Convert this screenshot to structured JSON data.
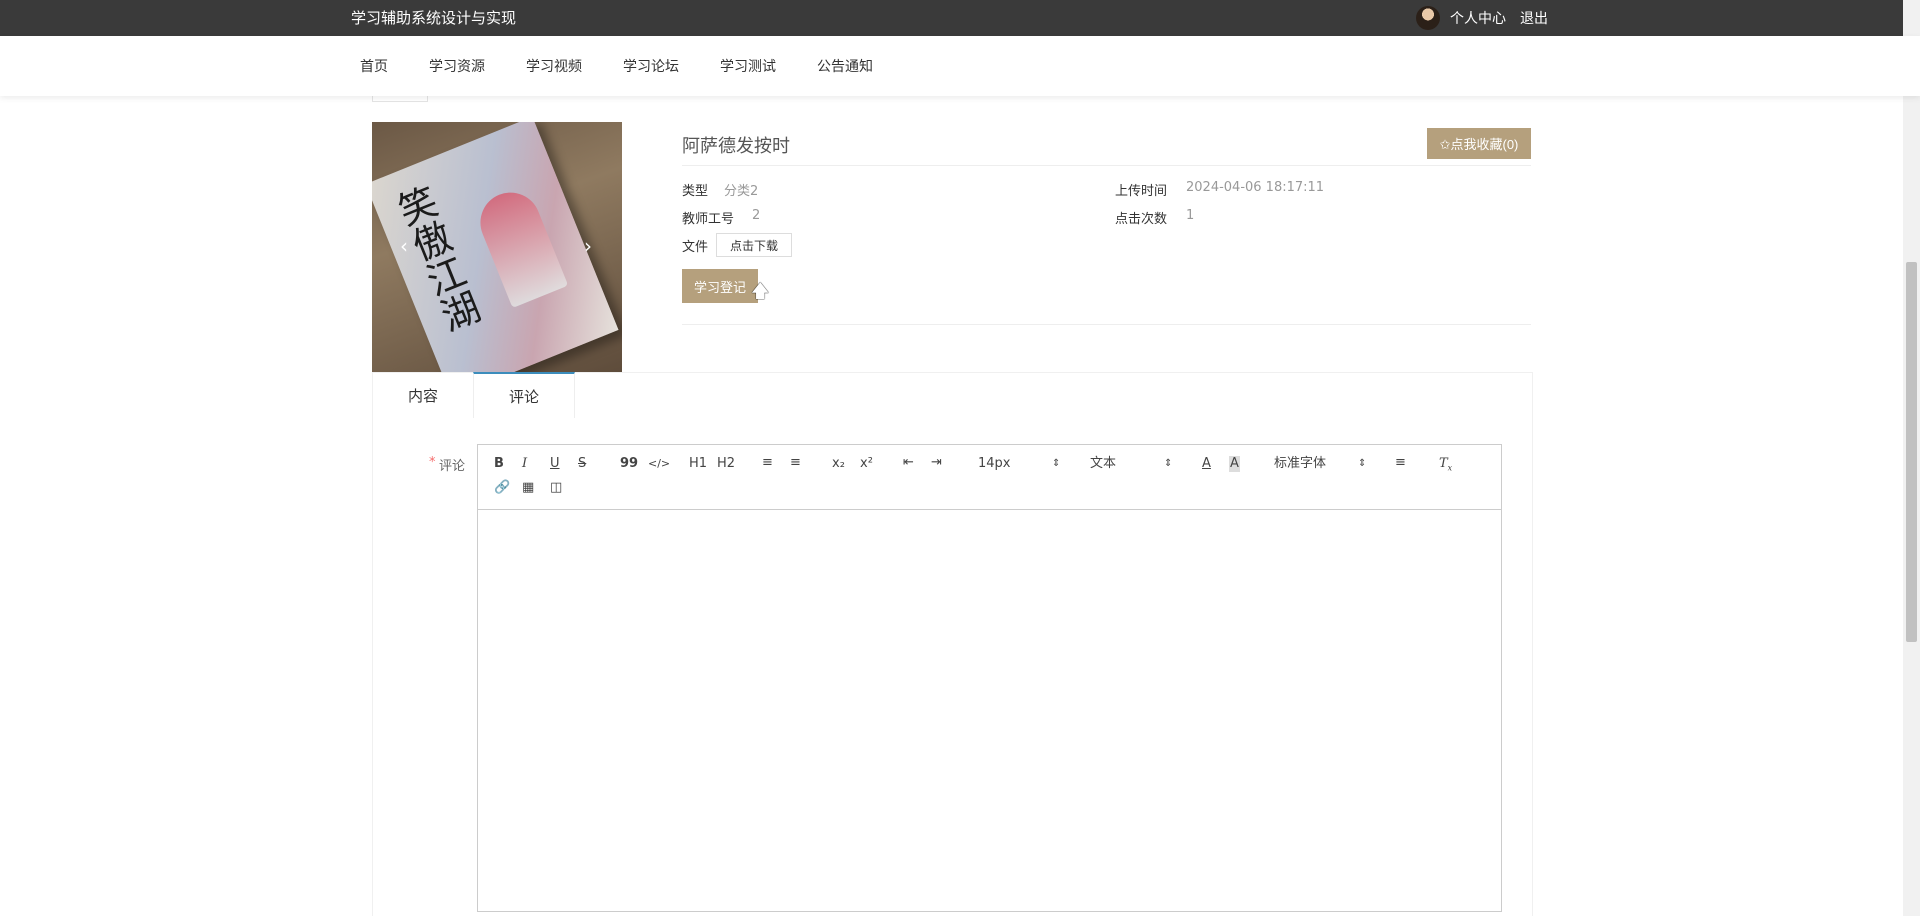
{
  "header": {
    "site_title": "学习辅助系统设计与实现",
    "personal_center": "个人中心",
    "logout": "退出"
  },
  "nav": {
    "items": [
      "首页",
      "学习资源",
      "学习视频",
      "学习论坛",
      "学习测试",
      "公告通知"
    ]
  },
  "cover": {
    "book_text": "笑傲江湖",
    "prev": "‹",
    "next": "›"
  },
  "detail": {
    "title": "阿萨德发按时",
    "favorite_button": "✩点我收藏(0)",
    "type_label": "类型",
    "type_value": "分类2",
    "teacher_label": "教师工号",
    "teacher_value": "2",
    "file_label": "文件",
    "download_button": "点击下载",
    "upload_label": "上传时间",
    "upload_value": "2024-04-06 18:17:11",
    "clicks_label": "点击次数",
    "clicks_value": "1",
    "study_button": "学习登记"
  },
  "tabs": {
    "content": "内容",
    "comment": "评论",
    "active": "评论"
  },
  "comment_form": {
    "required_mark": "*",
    "label": "评论",
    "editor": {
      "bold": "B",
      "italic": "I",
      "underline": "U",
      "strike": "S",
      "quote": "99",
      "code": "</>",
      "h1": "H1",
      "h2": "H2",
      "subscript": "x₂",
      "superscript": "x²",
      "size_value": "14px",
      "header_value": "文本",
      "font_value": "标准字体",
      "color_icon": "A",
      "background_icon": "A"
    }
  },
  "colors": {
    "accent": "#b5a07d",
    "topbar": "#3a3a3a",
    "tab_active_border": "#3c8dbc"
  }
}
